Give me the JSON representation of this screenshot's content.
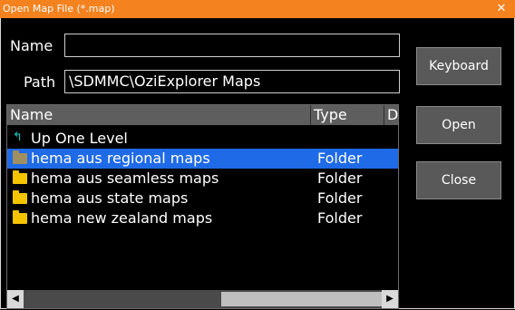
{
  "window": {
    "title": "Open Map File (*.map)",
    "close_glyph": "✕"
  },
  "form": {
    "name_label": "Name",
    "name_value": "",
    "path_label": "Path",
    "path_value": "\\SDMMC\\OziExplorer Maps"
  },
  "buttons": {
    "keyboard": "Keyboard",
    "open": "Open",
    "close": "Close"
  },
  "list": {
    "columns": [
      "Name",
      "Type",
      "D"
    ],
    "rows": [
      {
        "name": "Up One Level",
        "type": "",
        "icon": "up-level-icon",
        "selected": false
      },
      {
        "name": "hema aus regional maps",
        "type": "Folder",
        "icon": "folder-icon",
        "selected": true
      },
      {
        "name": "hema aus seamless maps",
        "type": "Folder",
        "icon": "folder-icon",
        "selected": false
      },
      {
        "name": "hema aus state maps",
        "type": "Folder",
        "icon": "folder-icon",
        "selected": false
      },
      {
        "name": "hema new zealand maps",
        "type": "Folder",
        "icon": "folder-icon",
        "selected": false
      }
    ]
  },
  "colors": {
    "title_bar": "#f3821f",
    "selection": "#1f6ae6",
    "folder": "#f5c400",
    "button": "#595959"
  }
}
